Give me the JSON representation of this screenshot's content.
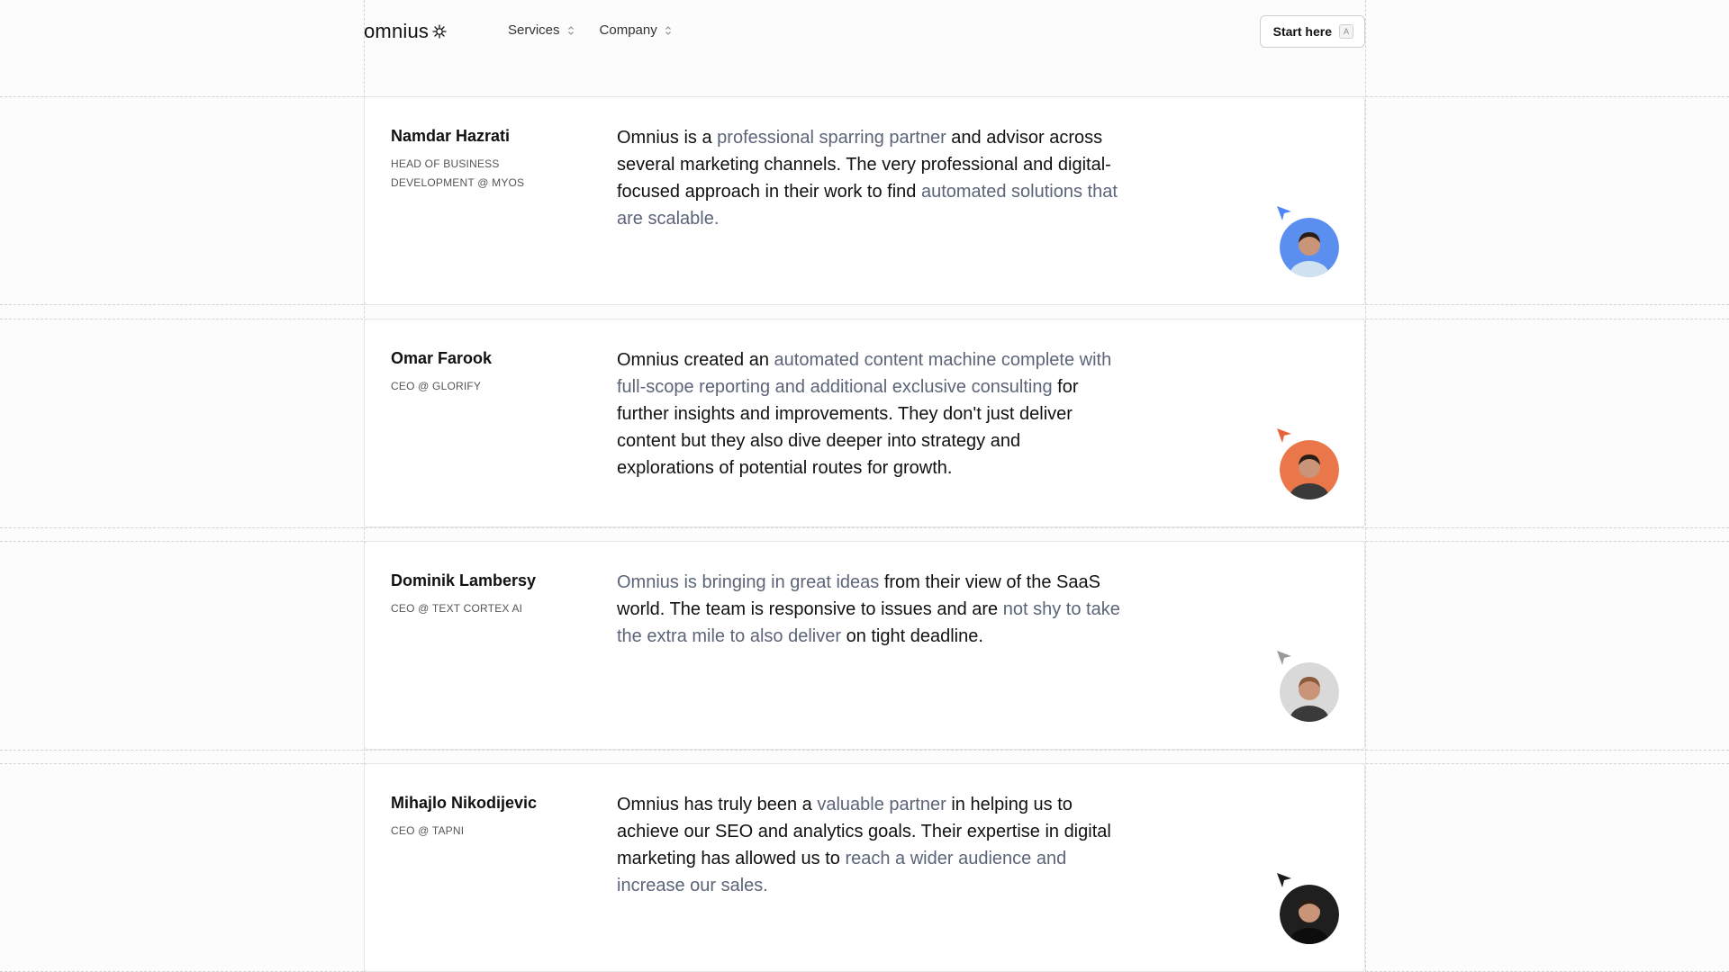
{
  "header": {
    "logo_text": "omnius",
    "logo_icon": "asterisk-sparkle-icon",
    "nav": [
      {
        "label": "Services"
      },
      {
        "label": "Company"
      }
    ],
    "cta": {
      "label": "Start here",
      "shortcut": "A"
    }
  },
  "testimonials": [
    {
      "name": "Namdar Hazrati",
      "role": "HEAD OF BUSINESS DEVELOPMENT @ MYOS",
      "quote": [
        {
          "text": "Omnius is a ",
          "highlight": false
        },
        {
          "text": "professional sparring partner",
          "highlight": true
        },
        {
          "text": " and advisor across several marketing channels. The very professional and digital-focused approach in their work to find ",
          "highlight": false
        },
        {
          "text": "automated solutions that are scalable.",
          "highlight": true
        }
      ],
      "cursor_color": "#4f86f7",
      "avatar_bg": "#5a8ff0"
    },
    {
      "name": "Omar Farook",
      "role": "CEO @ GLORIFY",
      "quote": [
        {
          "text": "Omnius created an ",
          "highlight": false
        },
        {
          "text": "automated content machine complete with full-scope reporting and additional exclusive consulting",
          "highlight": true
        },
        {
          "text": " for further insights and improvements. They don't just deliver content but they also dive deeper into strategy and explorations of potential routes for growth.",
          "highlight": false
        }
      ],
      "cursor_color": "#e8623a",
      "avatar_bg": "#e9774a"
    },
    {
      "name": "Dominik Lambersy",
      "role": "CEO @ TEXT CORTEX AI",
      "quote": [
        {
          "text": "Omnius is bringing in great ideas",
          "highlight": true
        },
        {
          "text": " from their view of the SaaS world. The team is responsive to issues and are ",
          "highlight": false
        },
        {
          "text": "not shy to take the extra mile to also deliver",
          "highlight": true
        },
        {
          "text": " on tight deadline.",
          "highlight": false
        }
      ],
      "cursor_color": "#9a9a9a",
      "avatar_bg": "#d9d9d9"
    },
    {
      "name": "Mihajlo Nikodijevic",
      "role": "CEO @ TAPNI",
      "quote": [
        {
          "text": "Omnius has truly been a ",
          "highlight": false
        },
        {
          "text": "valuable partner",
          "highlight": true
        },
        {
          "text": " in helping us to achieve our SEO and analytics goals. Their expertise in digital marketing has allowed us to ",
          "highlight": false
        },
        {
          "text": "reach a wider audience and increase our sales.",
          "highlight": true
        }
      ],
      "cursor_color": "#1a1a1a",
      "avatar_bg": "#1f1f1f"
    }
  ]
}
